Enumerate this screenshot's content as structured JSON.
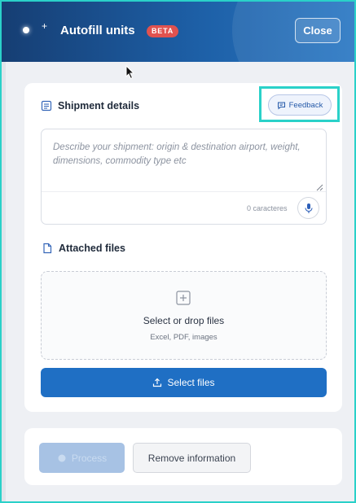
{
  "header": {
    "title": "Autofill units",
    "badge": "BETA",
    "close_label": "Close"
  },
  "shipment": {
    "title": "Shipment details",
    "feedback_label": "Feedback",
    "placeholder": "Describe your shipment: origin & destination airport, weight, dimensions, commodity type etc",
    "char_count": "0 caracteres"
  },
  "attached": {
    "title": "Attached files",
    "drop_title": "Select or drop files",
    "drop_sub": "Excel, PDF, images",
    "select_files_label": "Select files"
  },
  "footer": {
    "process_label": "Process",
    "remove_label": "Remove information"
  },
  "colors": {
    "accent": "#1f6fc4",
    "highlight": "#2ad1c9",
    "beta": "#e0524f"
  },
  "icons": [
    "sparkle-icon",
    "document-list-icon",
    "feedback-chat-icon",
    "microphone-icon",
    "file-icon",
    "plus-square-icon",
    "upload-icon"
  ]
}
